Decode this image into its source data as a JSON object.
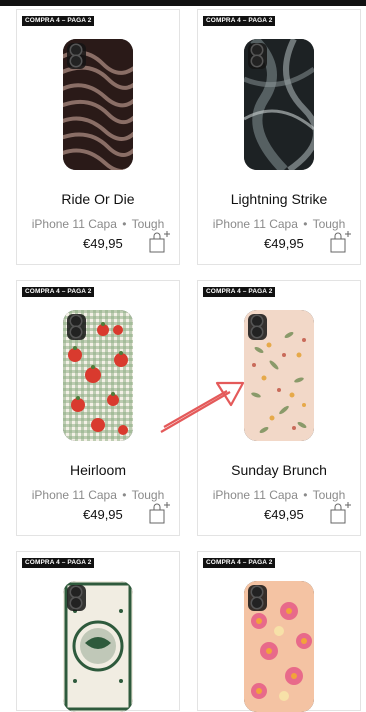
{
  "badge_text": "COMPRA 4 – PAGA 2",
  "products": [
    {
      "name": "Ride Or Die",
      "device": "iPhone 11 Capa",
      "separator": "•",
      "type": "Tough",
      "price": "€49,95",
      "add_icon": "bag-plus-icon"
    },
    {
      "name": "Lightning Strike",
      "device": "iPhone 11 Capa",
      "separator": "•",
      "type": "Tough",
      "price": "€49,95",
      "add_icon": "bag-plus-icon"
    },
    {
      "name": "Heirloom",
      "device": "iPhone 11 Capa",
      "separator": "•",
      "type": "Tough",
      "price": "€49,95",
      "add_icon": "bag-plus-icon"
    },
    {
      "name": "Sunday Brunch",
      "device": "iPhone 11 Capa",
      "separator": "•",
      "type": "Tough",
      "price": "€49,95",
      "add_icon": "bag-plus-icon"
    },
    {
      "name": "",
      "device": "",
      "separator": "",
      "type": "",
      "price": "",
      "add_icon": ""
    },
    {
      "name": "",
      "device": "",
      "separator": "",
      "type": "",
      "price": "",
      "add_icon": ""
    }
  ],
  "colors": {
    "annotation_arrow": "#e45a5a",
    "badge_bg": "#111111",
    "meta_text": "#8a8a8a"
  }
}
